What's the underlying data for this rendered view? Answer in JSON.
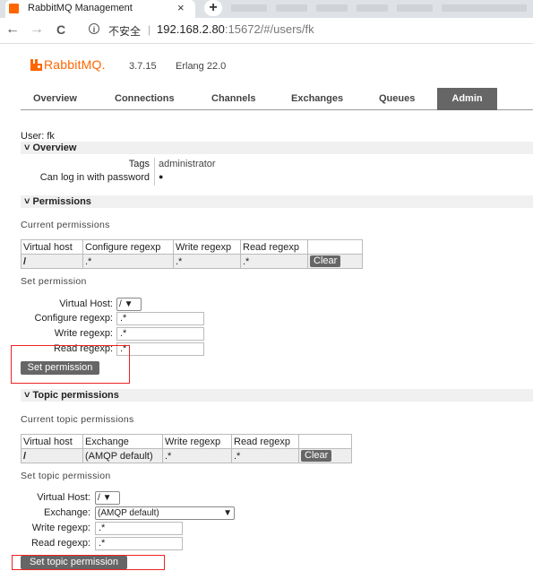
{
  "browser": {
    "tab_title": "RabbitMQ Management",
    "tab_close": "×",
    "new_tab": "+",
    "back": "←",
    "forward": "→",
    "reload": "C",
    "security_label": "不安全",
    "separator": "|",
    "url_host": "192.168.2.80",
    "url_rest": ":15672/#/users/fk"
  },
  "app": {
    "name_rabbit": "RabbitMQ.",
    "version": "3.7.15",
    "erlang": "Erlang 22.0",
    "brand_color": "#ff6600"
  },
  "nav": {
    "tabs": [
      "Overview",
      "Connections",
      "Channels",
      "Exchanges",
      "Queues",
      "Admin"
    ],
    "active": "Admin"
  },
  "user": {
    "title": "User: fk",
    "overview_heading": "Overview",
    "tags_label": "Tags",
    "tags_value": "administrator",
    "login_label": "Can log in with password",
    "login_value": "●"
  },
  "permissions": {
    "heading": "Permissions",
    "current_heading": "Current permissions",
    "columns": [
      "Virtual host",
      "Configure regexp",
      "Write regexp",
      "Read regexp",
      ""
    ],
    "rows": [
      {
        "vhost": "/",
        "configure": ".*",
        "write": ".*",
        "read": ".*",
        "action": "Clear"
      }
    ],
    "set_heading": "Set permission",
    "vhost_label": "Virtual Host:",
    "vhost_value": "/",
    "configure_label": "Configure regexp:",
    "configure_value": ".*",
    "write_label": "Write regexp:",
    "write_value": ".*",
    "read_label": "Read regexp:",
    "read_value": ".*",
    "submit": "Set permission"
  },
  "topic_permissions": {
    "heading": "Topic permissions",
    "current_heading": "Current topic permissions",
    "columns": [
      "Virtual host",
      "Exchange",
      "Write regexp",
      "Read regexp",
      ""
    ],
    "rows": [
      {
        "vhost": "/",
        "exchange": "(AMQP default)",
        "write": ".*",
        "read": ".*",
        "action": "Clear"
      }
    ],
    "set_heading": "Set topic permission",
    "vhost_label": "Virtual Host:",
    "vhost_value": "/",
    "exchange_label": "Exchange:",
    "exchange_value": "(AMQP default)",
    "write_label": "Write regexp:",
    "write_value": ".*",
    "read_label": "Read regexp:",
    "read_value": ".*",
    "submit": "Set topic permission"
  },
  "icons": {
    "dropdown": "▼",
    "section_toggle": "˅"
  }
}
